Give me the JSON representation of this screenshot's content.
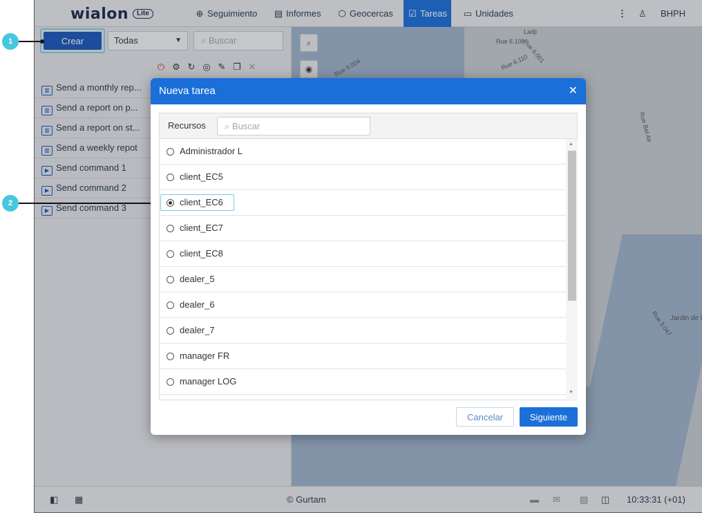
{
  "topbar": {
    "logo": "wialon",
    "logo_badge": "Lite",
    "tabs": [
      {
        "label": "Seguimiento",
        "icon": "globe-icon",
        "glyph": "⊕"
      },
      {
        "label": "Informes",
        "icon": "report-icon",
        "glyph": "▤"
      },
      {
        "label": "Geocercas",
        "icon": "geofence-icon",
        "glyph": "⬡"
      },
      {
        "label": "Tareas",
        "icon": "tasks-icon",
        "glyph": "☑"
      },
      {
        "label": "Unidades",
        "icon": "units-icon",
        "glyph": "▭"
      }
    ],
    "user": "BHPH"
  },
  "left_panel": {
    "create_label": "Crear",
    "filter_value": "Todas",
    "search_placeholder": "Buscar",
    "tasks": [
      {
        "label": "Send a monthly rep...",
        "type": "report"
      },
      {
        "label": "Send a report on p...",
        "type": "report"
      },
      {
        "label": "Send a report on st...",
        "type": "report"
      },
      {
        "label": "Send a weekly repot",
        "type": "report"
      },
      {
        "label": "Send command 1",
        "type": "command"
      },
      {
        "label": "Send command 2",
        "type": "command"
      },
      {
        "label": "Send command 3",
        "type": "command"
      }
    ]
  },
  "map": {
    "labels": [
      "Ladji",
      "Rue 6.108",
      "Rue 6.001",
      "Rue 6.110",
      "Rue 9.004",
      "Rue Bel Air",
      "Rue 3.047",
      "Jardin de l"
    ]
  },
  "dialog": {
    "title": "Nueva tarea",
    "resources_label": "Recursos",
    "search_placeholder": "Buscar",
    "resources": [
      {
        "name": "Administrador L",
        "selected": false
      },
      {
        "name": "client_EC5",
        "selected": false
      },
      {
        "name": "client_EC6",
        "selected": true
      },
      {
        "name": "client_EC7",
        "selected": false
      },
      {
        "name": "client_EC8",
        "selected": false
      },
      {
        "name": "dealer_5",
        "selected": false
      },
      {
        "name": "dealer_6",
        "selected": false
      },
      {
        "name": "dealer_7",
        "selected": false
      },
      {
        "name": "manager FR",
        "selected": false
      },
      {
        "name": "manager LOG",
        "selected": false
      }
    ],
    "cancel_label": "Cancelar",
    "next_label": "Siguiente"
  },
  "bottombar": {
    "copyright": "© Gurtam",
    "time": "10:33:31 (+01)"
  },
  "callouts": [
    "1",
    "2"
  ],
  "colors": {
    "accent": "#1b6fd8",
    "callout": "#46c7de"
  }
}
